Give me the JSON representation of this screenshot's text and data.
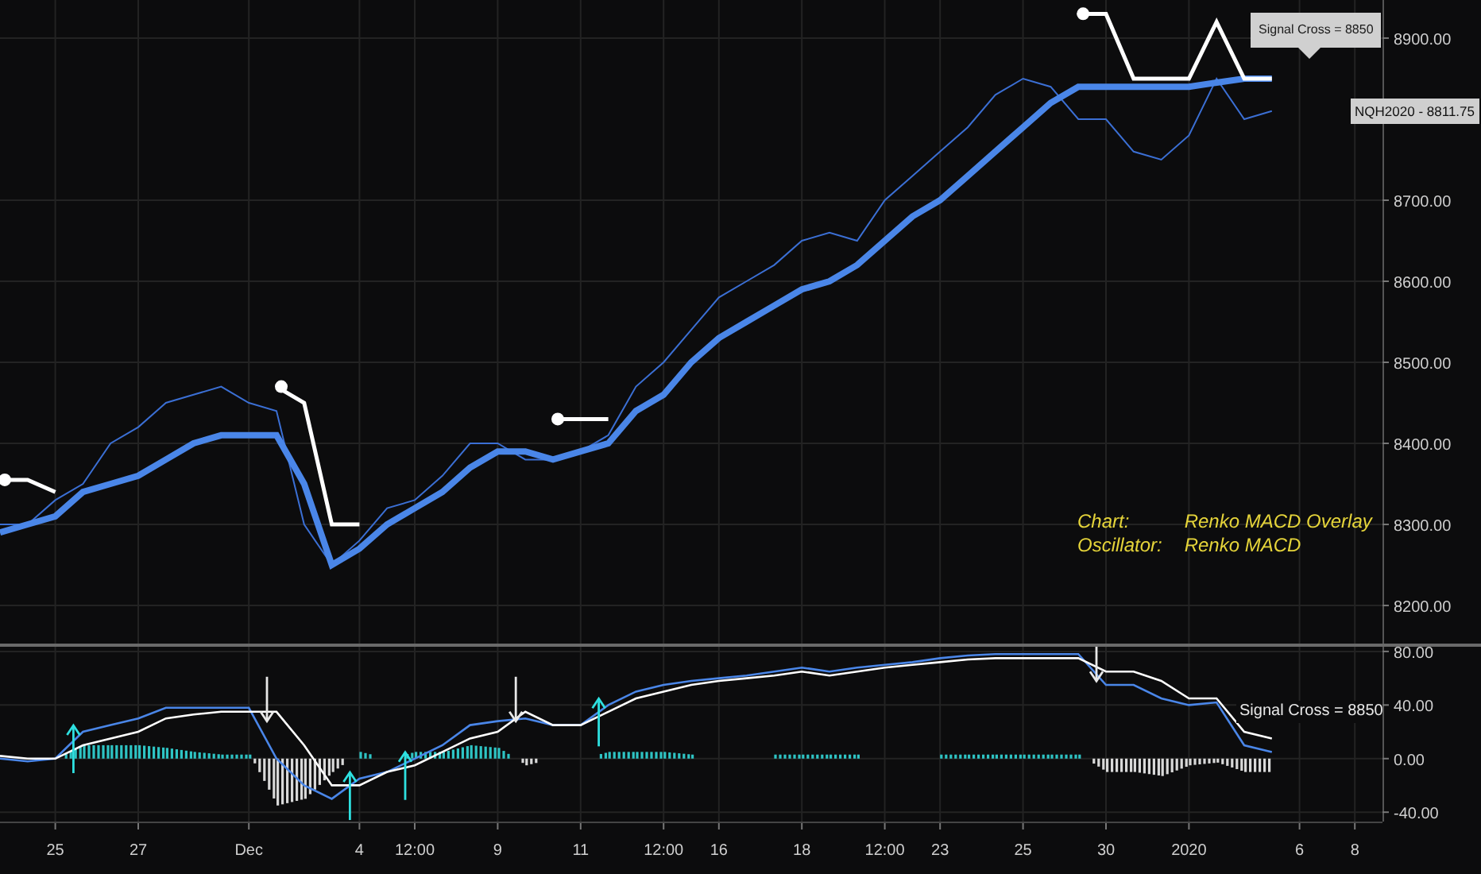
{
  "main_chart": {
    "chart_data": {
      "type": "line",
      "categories": [
        null,
        null,
        null,
        null,
        null,
        null,
        null,
        null,
        null,
        null,
        null,
        null,
        null,
        null,
        null,
        null,
        null,
        null,
        null,
        null,
        null,
        null,
        null,
        null,
        null,
        null,
        null,
        null,
        null,
        null,
        null,
        null,
        null,
        null,
        null,
        null,
        null,
        null,
        null,
        null,
        null,
        null,
        null,
        null,
        null,
        null,
        null,
        null,
        null,
        null,
        null
      ],
      "ylim": [
        8153,
        8947
      ],
      "grid": true,
      "series": [
        {
          "color": "#3b6fd4",
          "values": [
            8300,
            8300,
            8330,
            8350,
            8400,
            8420,
            8450,
            8460,
            8470,
            8450,
            8440,
            8300,
            8250,
            8280,
            8320,
            8330,
            8360,
            8400,
            8400,
            8380,
            8380,
            8390,
            8410,
            8470,
            8500,
            8540,
            8580,
            8600,
            8620,
            8650,
            8660,
            8650,
            8700,
            8730,
            8760,
            8790,
            8830,
            8850,
            8840,
            8800,
            8800,
            8760,
            8750,
            8780,
            8850,
            8800,
            8810,
            null,
            null,
            null,
            null
          ]
        },
        {
          "color": "#4a86e8",
          "values": [
            8290,
            8300,
            8310,
            8340,
            8350,
            8360,
            8380,
            8400,
            8410,
            8410,
            8410,
            8350,
            8250,
            8270,
            8300,
            8320,
            8340,
            8370,
            8390,
            8390,
            8380,
            8390,
            8400,
            8440,
            8460,
            8500,
            8530,
            8550,
            8570,
            8590,
            8600,
            8620,
            8650,
            8680,
            8700,
            8730,
            8760,
            8790,
            8820,
            8840,
            8840,
            8840,
            8840,
            8840,
            8845,
            8850,
            8850,
            null,
            null,
            null,
            null
          ]
        },
        {
          "color": "#ffffff",
          "values": [
            8355,
            8355,
            8340,
            null,
            null,
            null,
            null,
            null,
            null,
            null,
            8470,
            8450,
            8300,
            8300,
            null,
            null,
            null,
            null,
            null,
            null,
            8430,
            8430,
            8430,
            null,
            null,
            null,
            null,
            null,
            null,
            null,
            null,
            null,
            null,
            null,
            null,
            null,
            null,
            null,
            null,
            8930,
            8930,
            8850,
            8850,
            8850,
            8920,
            8850,
            8850,
            null,
            null,
            null,
            null
          ]
        }
      ],
      "yticks": [
        {
          "value": 8200,
          "label": "8200.00"
        },
        {
          "value": 8300,
          "label": "8300.00"
        },
        {
          "value": 8400,
          "label": "8400.00"
        },
        {
          "value": 8500,
          "label": "8500.00"
        },
        {
          "value": 8600,
          "label": "8600.00"
        },
        {
          "value": 8700,
          "label": "8700.00"
        },
        {
          "value": 8900,
          "label": "8900.00"
        }
      ]
    },
    "tooltip": "Signal Cross = 8850",
    "price_label": "NQH2020 - 8811.75",
    "legend": [
      {
        "label": "Chart:",
        "value": "Renko MACD Overlay"
      },
      {
        "label": "Oscillator:",
        "value": "Renko MACD"
      }
    ]
  },
  "oscillator": {
    "chart_data": {
      "type": "line",
      "categories": [
        null,
        null,
        "25",
        null,
        null,
        "27",
        null,
        null,
        null,
        "Dec",
        null,
        null,
        null,
        "4",
        null,
        "12:00",
        null,
        null,
        "9",
        null,
        null,
        "11",
        null,
        null,
        "12:00",
        null,
        "16",
        null,
        null,
        "18",
        null,
        null,
        "12:00",
        null,
        "23",
        null,
        null,
        "25",
        null,
        null,
        "30",
        null,
        null,
        "2020",
        null,
        null,
        null,
        "6",
        null,
        "8",
        null
      ],
      "ylim": [
        -47,
        83.5
      ],
      "grid": true,
      "series": [
        {
          "color": "#4a86e8",
          "values": [
            0,
            -2,
            0,
            20,
            25,
            30,
            38,
            38,
            38,
            38,
            0,
            -20,
            -30,
            -15,
            -10,
            0,
            10,
            25,
            28,
            30,
            25,
            25,
            40,
            50,
            55,
            58,
            60,
            62,
            65,
            68,
            65,
            68,
            70,
            72,
            75,
            77,
            78,
            78,
            78,
            78,
            55,
            55,
            45,
            40,
            42,
            10,
            5,
            null,
            null,
            null,
            null
          ]
        },
        {
          "color": "#ffffff",
          "values": [
            2,
            0,
            0,
            10,
            15,
            20,
            30,
            33,
            35,
            35,
            35,
            10,
            -20,
            -20,
            -10,
            -5,
            5,
            15,
            20,
            35,
            25,
            25,
            35,
            45,
            50,
            55,
            58,
            60,
            62,
            65,
            62,
            65,
            68,
            70,
            72,
            74,
            75,
            75,
            75,
            75,
            65,
            65,
            58,
            45,
            45,
            20,
            15,
            null,
            null,
            null,
            null
          ]
        }
      ],
      "yticks": [
        {
          "value": 80,
          "label": "80.00"
        },
        {
          "value": 40,
          "label": "40.00"
        },
        {
          "value": 0,
          "label": "0.00"
        },
        {
          "value": -40,
          "label": "-40.00"
        }
      ]
    },
    "label": "Signal Cross = 8850"
  }
}
